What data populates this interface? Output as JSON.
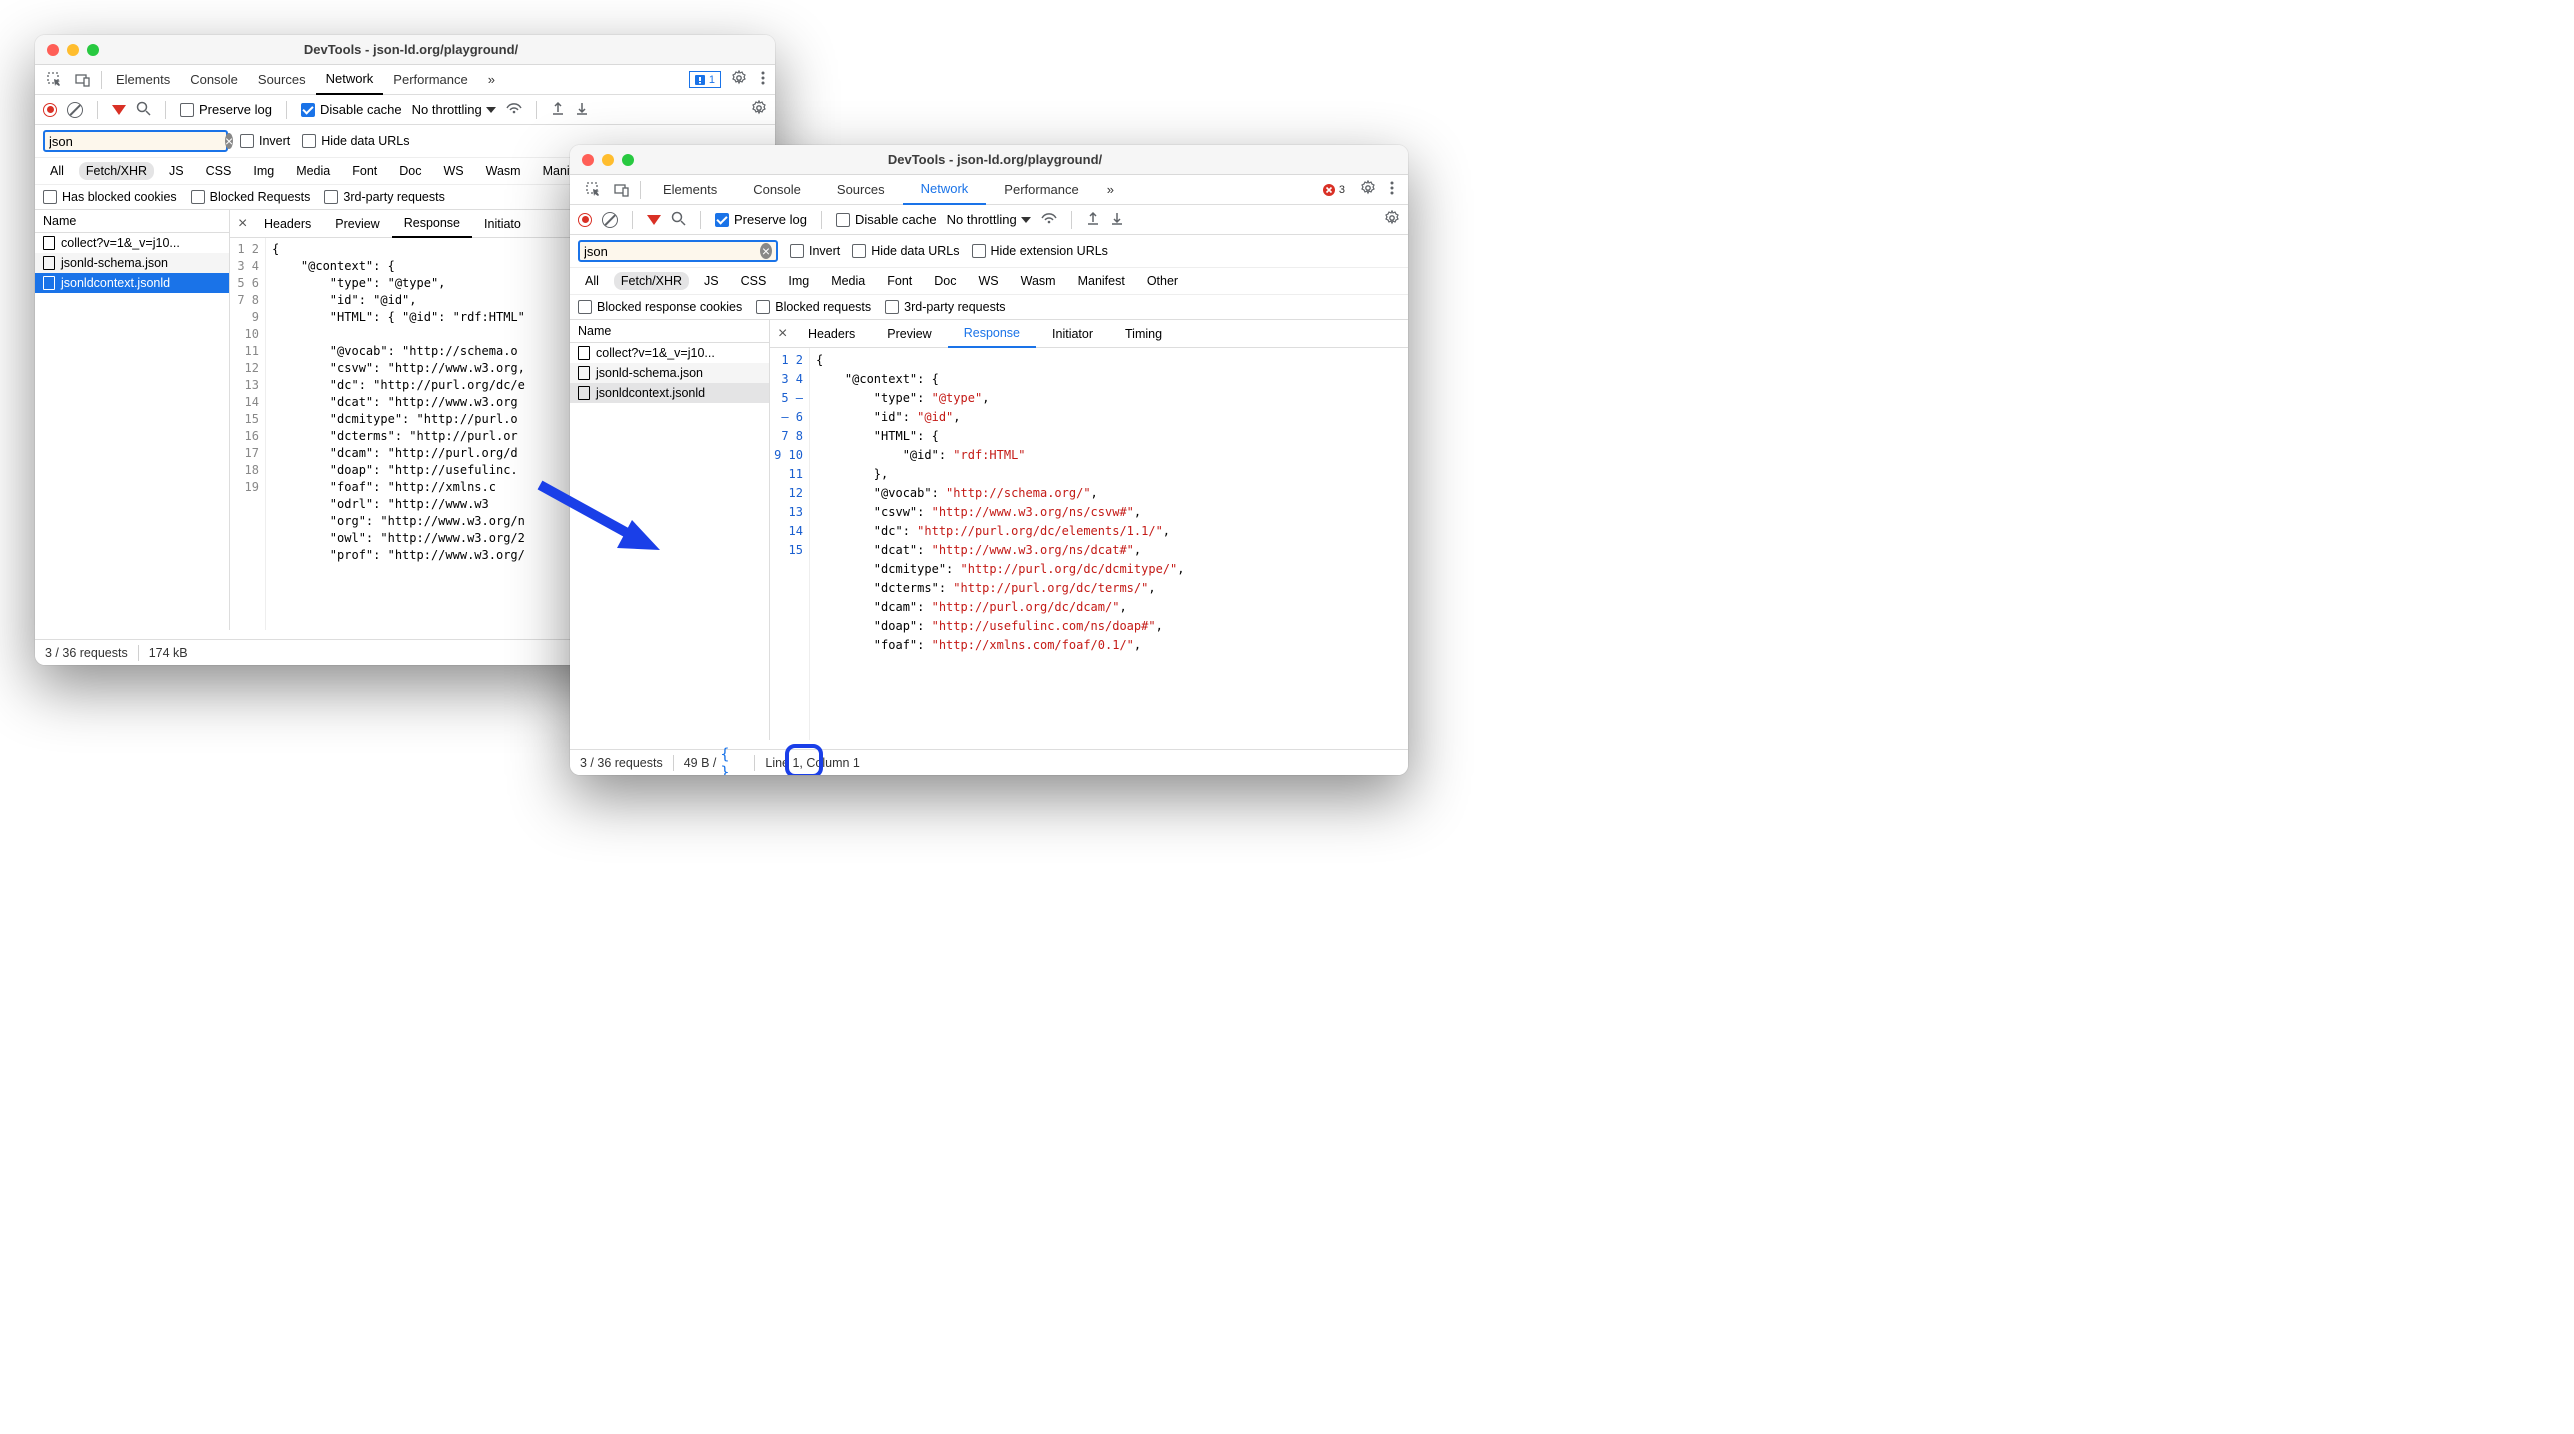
{
  "window1": {
    "title": "DevTools - json-ld.org/playground/",
    "tabs": [
      "Elements",
      "Console",
      "Sources",
      "Network",
      "Performance"
    ],
    "more": "»",
    "issues_count": "1",
    "toolbar": {
      "preserve_log": "Preserve log",
      "disable_cache": "Disable cache",
      "throttle": "No throttling"
    },
    "filter": {
      "value": "json",
      "invert": "Invert",
      "hide_urls": "Hide data URLs"
    },
    "types": [
      "All",
      "Fetch/XHR",
      "JS",
      "CSS",
      "Img",
      "Media",
      "Font",
      "Doc",
      "WS",
      "Wasm",
      "Manifest"
    ],
    "checks": {
      "blocked_cookies": "Has blocked cookies",
      "blocked_req": "Blocked Requests",
      "third": "3rd-party requests"
    },
    "name_header": "Name",
    "files": [
      "collect?v=1&_v=j10...",
      "jsonld-schema.json",
      "jsonldcontext.jsonld"
    ],
    "detail_tabs": [
      "Headers",
      "Preview",
      "Response",
      "Initiato"
    ],
    "status": {
      "requests": "3 / 36 requests",
      "size": "174 kB"
    }
  },
  "window2": {
    "title": "DevTools - json-ld.org/playground/",
    "tabs": [
      "Elements",
      "Console",
      "Sources",
      "Network",
      "Performance"
    ],
    "more": "»",
    "error_count": "3",
    "toolbar": {
      "preserve_log": "Preserve log",
      "disable_cache": "Disable cache",
      "throttle": "No throttling"
    },
    "filter": {
      "value": "json",
      "invert": "Invert",
      "hide_urls": "Hide data URLs",
      "hide_ext": "Hide extension URLs"
    },
    "types": [
      "All",
      "Fetch/XHR",
      "JS",
      "CSS",
      "Img",
      "Media",
      "Font",
      "Doc",
      "WS",
      "Wasm",
      "Manifest",
      "Other"
    ],
    "checks": {
      "blocked_cookies": "Blocked response cookies",
      "blocked_req": "Blocked requests",
      "third": "3rd-party requests"
    },
    "name_header": "Name",
    "files": [
      "collect?v=1&_v=j10...",
      "jsonld-schema.json",
      "jsonldcontext.jsonld"
    ],
    "detail_tabs": [
      "Headers",
      "Preview",
      "Response",
      "Initiator",
      "Timing"
    ],
    "status": {
      "requests": "3 / 36 requests",
      "size": "49 B /",
      "cursor": "Line 1, Column 1"
    }
  },
  "code1_lines": [
    "1",
    "2",
    "3",
    "4",
    "5",
    "6",
    "7",
    "8",
    "9",
    "10",
    "11",
    "12",
    "13",
    "14",
    "15",
    "16",
    "17",
    "18",
    "19"
  ],
  "code1": {
    "l1": "{",
    "l2": "    \"@context\": {",
    "l3": "        \"type\": \"@type\",",
    "l4": "        \"id\": \"@id\",",
    "l5": "        \"HTML\": { \"@id\": \"rdf:HTML\"",
    "l6": "",
    "l7": "        \"@vocab\": \"http://schema.o",
    "l8": "        \"csvw\": \"http://www.w3.org,",
    "l9": "        \"dc\": \"http://purl.org/dc/e",
    "l10": "        \"dcat\": \"http://www.w3.org",
    "l11": "        \"dcmitype\": \"http://purl.o",
    "l12": "        \"dcterms\": \"http://purl.or",
    "l13": "        \"dcam\": \"http://purl.org/d",
    "l14": "        \"doap\": \"http://usefulinc.",
    "l15": "        \"foaf\": \"http://xmlns.c",
    "l16": "        \"odrl\": \"http://www.w3",
    "l17": "        \"org\": \"http://www.w3.org/n",
    "l18": "        \"owl\": \"http://www.w3.org/2",
    "l19": "        \"prof\": \"http://www.w3.org/"
  },
  "code2_lines": [
    "1",
    "2",
    "3",
    "4",
    "5",
    "–",
    "–",
    "6",
    "7",
    "8",
    "9",
    "10",
    "11",
    "12",
    "13",
    "14",
    "15"
  ],
  "code2": [
    [
      [
        "p",
        "{"
      ]
    ],
    [
      [
        "sp",
        "    "
      ],
      [
        "k",
        "\"@context\""
      ],
      [
        "p",
        ": {"
      ]
    ],
    [
      [
        "sp",
        "        "
      ],
      [
        "k",
        "\"type\""
      ],
      [
        "p",
        ": "
      ],
      [
        "s",
        "\"@type\""
      ],
      [
        "p",
        ","
      ]
    ],
    [
      [
        "sp",
        "        "
      ],
      [
        "k",
        "\"id\""
      ],
      [
        "p",
        ": "
      ],
      [
        "s",
        "\"@id\""
      ],
      [
        "p",
        ","
      ]
    ],
    [
      [
        "sp",
        "        "
      ],
      [
        "k",
        "\"HTML\""
      ],
      [
        "p",
        ": {"
      ]
    ],
    [
      [
        "sp",
        "            "
      ],
      [
        "k",
        "\"@id\""
      ],
      [
        "p",
        ": "
      ],
      [
        "s",
        "\"rdf:HTML\""
      ]
    ],
    [
      [
        "sp",
        "        "
      ],
      [
        "p",
        "},"
      ]
    ],
    [
      [
        "sp",
        "        "
      ],
      [
        "k",
        "\"@vocab\""
      ],
      [
        "p",
        ": "
      ],
      [
        "s",
        "\"http://schema.org/\""
      ],
      [
        "p",
        ","
      ]
    ],
    [
      [
        "sp",
        "        "
      ],
      [
        "k",
        "\"csvw\""
      ],
      [
        "p",
        ": "
      ],
      [
        "s",
        "\"http://www.w3.org/ns/csvw#\""
      ],
      [
        "p",
        ","
      ]
    ],
    [
      [
        "sp",
        "        "
      ],
      [
        "k",
        "\"dc\""
      ],
      [
        "p",
        ": "
      ],
      [
        "s",
        "\"http://purl.org/dc/elements/1.1/\""
      ],
      [
        "p",
        ","
      ]
    ],
    [
      [
        "sp",
        "        "
      ],
      [
        "k",
        "\"dcat\""
      ],
      [
        "p",
        ": "
      ],
      [
        "s",
        "\"http://www.w3.org/ns/dcat#\""
      ],
      [
        "p",
        ","
      ]
    ],
    [
      [
        "sp",
        "        "
      ],
      [
        "k",
        "\"dcmitype\""
      ],
      [
        "p",
        ": "
      ],
      [
        "s",
        "\"http://purl.org/dc/dcmitype/\""
      ],
      [
        "p",
        ","
      ]
    ],
    [
      [
        "sp",
        "        "
      ],
      [
        "k",
        "\"dcterms\""
      ],
      [
        "p",
        ": "
      ],
      [
        "s",
        "\"http://purl.org/dc/terms/\""
      ],
      [
        "p",
        ","
      ]
    ],
    [
      [
        "sp",
        "        "
      ],
      [
        "k",
        "\"dcam\""
      ],
      [
        "p",
        ": "
      ],
      [
        "s",
        "\"http://purl.org/dc/dcam/\""
      ],
      [
        "p",
        ","
      ]
    ],
    [
      [
        "sp",
        "        "
      ],
      [
        "k",
        "\"doap\""
      ],
      [
        "p",
        ": "
      ],
      [
        "s",
        "\"http://usefulinc.com/ns/doap#\""
      ],
      [
        "p",
        ","
      ]
    ],
    [
      [
        "sp",
        "        "
      ],
      [
        "k",
        "\"foaf\""
      ],
      [
        "p",
        ": "
      ],
      [
        "s",
        "\"http://xmlns.com/foaf/0.1/\""
      ],
      [
        "p",
        ","
      ]
    ]
  ]
}
